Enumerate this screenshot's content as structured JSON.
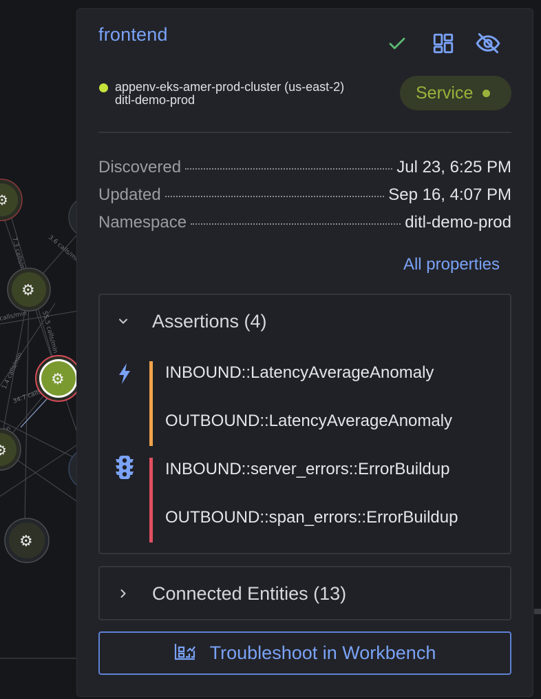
{
  "graph": {
    "edge_labels": [
      "7.3 calls/min",
      "3.6 calls/min",
      "55.5 calls/min",
      "1.4 calls/min",
      "calls/min",
      "min",
      "34.7 calls/min"
    ]
  },
  "panel": {
    "entity_name": "frontend",
    "cluster": {
      "name": "appenv-eks-amer-prod-cluster (us-east-2)",
      "namespace_line": "ditl-demo-prod",
      "status_color": "#c7e23a"
    },
    "type_badge": {
      "label": "Service",
      "color": "#9bb23a"
    },
    "header_icons": [
      "check-icon",
      "dashboard-icon",
      "visibility-off-icon"
    ],
    "properties": [
      {
        "key": "Discovered",
        "value": "Jul 23, 6:25 PM"
      },
      {
        "key": "Updated",
        "value": "Sep 16, 4:07 PM"
      },
      {
        "key": "Namespace",
        "value": "ditl-demo-prod"
      }
    ],
    "all_properties_label": "All properties",
    "assertions": {
      "title": "Assertions (4)",
      "expanded": true,
      "groups": [
        {
          "icon": "lightning-icon",
          "color": "#f0a24b",
          "items": [
            "INBOUND::LatencyAverageAnomaly",
            "OUTBOUND::LatencyAverageAnomaly"
          ]
        },
        {
          "icon": "traffic-light-icon",
          "color": "#e0505f",
          "items": [
            "INBOUND::server_errors::ErrorBuildup",
            "OUTBOUND::span_errors::ErrorBuildup"
          ]
        }
      ]
    },
    "connected_entities": {
      "title": "Connected Entities (13)",
      "expanded": false
    },
    "troubleshoot_button": {
      "label": "Troubleshoot in Workbench",
      "icon": "workbench-icon"
    }
  },
  "colors": {
    "accent": "#7aa2f7",
    "panel_bg": "#222328",
    "page_bg": "#16171b"
  }
}
